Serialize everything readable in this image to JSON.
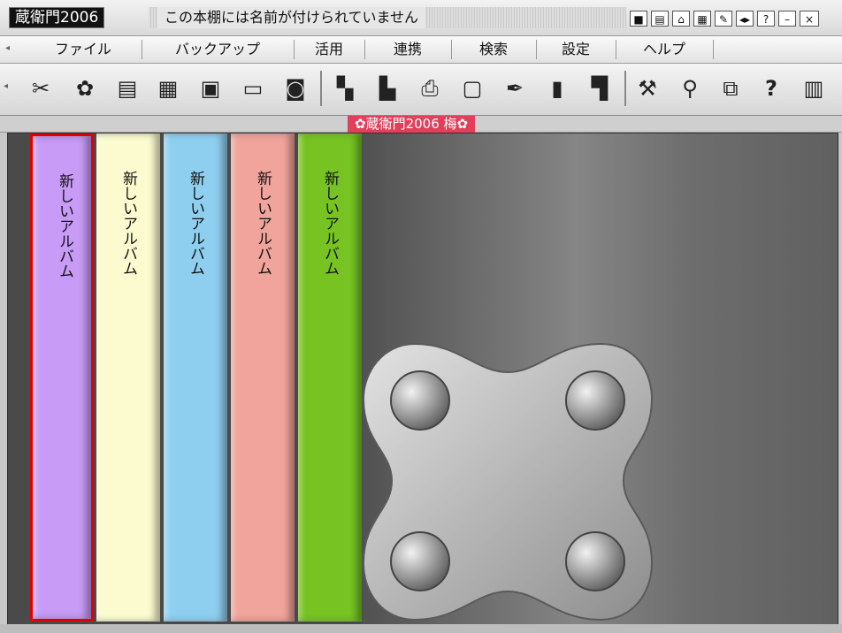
{
  "app": {
    "name": "蔵衛門2006",
    "title": "この本棚には名前が付けられていません"
  },
  "window_controls": [
    "■",
    "▤",
    "⌂",
    "▦",
    "✎",
    "◂▸",
    "?",
    "–",
    "×"
  ],
  "menu": [
    "ファイル",
    "バックアップ",
    "活用",
    "連携",
    "検索",
    "設定",
    "ヘルプ"
  ],
  "toolbar_icons": [
    "scissors-icon",
    "paint-icon",
    "card-icon",
    "save-icon",
    "edit-icon",
    "laptop-icon",
    "disk-icon",
    "export-icon",
    "layout-icon",
    "print-icon",
    "monitor-icon",
    "pen-icon",
    "book-icon",
    "floppy-icon",
    "tools-icon",
    "search-icon",
    "network-icon",
    "help-icon",
    "trash-icon"
  ],
  "shelf": {
    "label": "✿蔵衛門2006 梅✿"
  },
  "albums": [
    {
      "title": "新しいアルバム",
      "color": "#c89bf7",
      "selected": true
    },
    {
      "title": "新しいアルバム",
      "color": "#fbfbcf",
      "selected": false
    },
    {
      "title": "新しいアルバム",
      "color": "#8ecff0",
      "selected": false
    },
    {
      "title": "新しいアルバム",
      "color": "#f1a49b",
      "selected": false
    },
    {
      "title": "新しいアルバム",
      "color": "#76c322",
      "selected": false
    }
  ]
}
